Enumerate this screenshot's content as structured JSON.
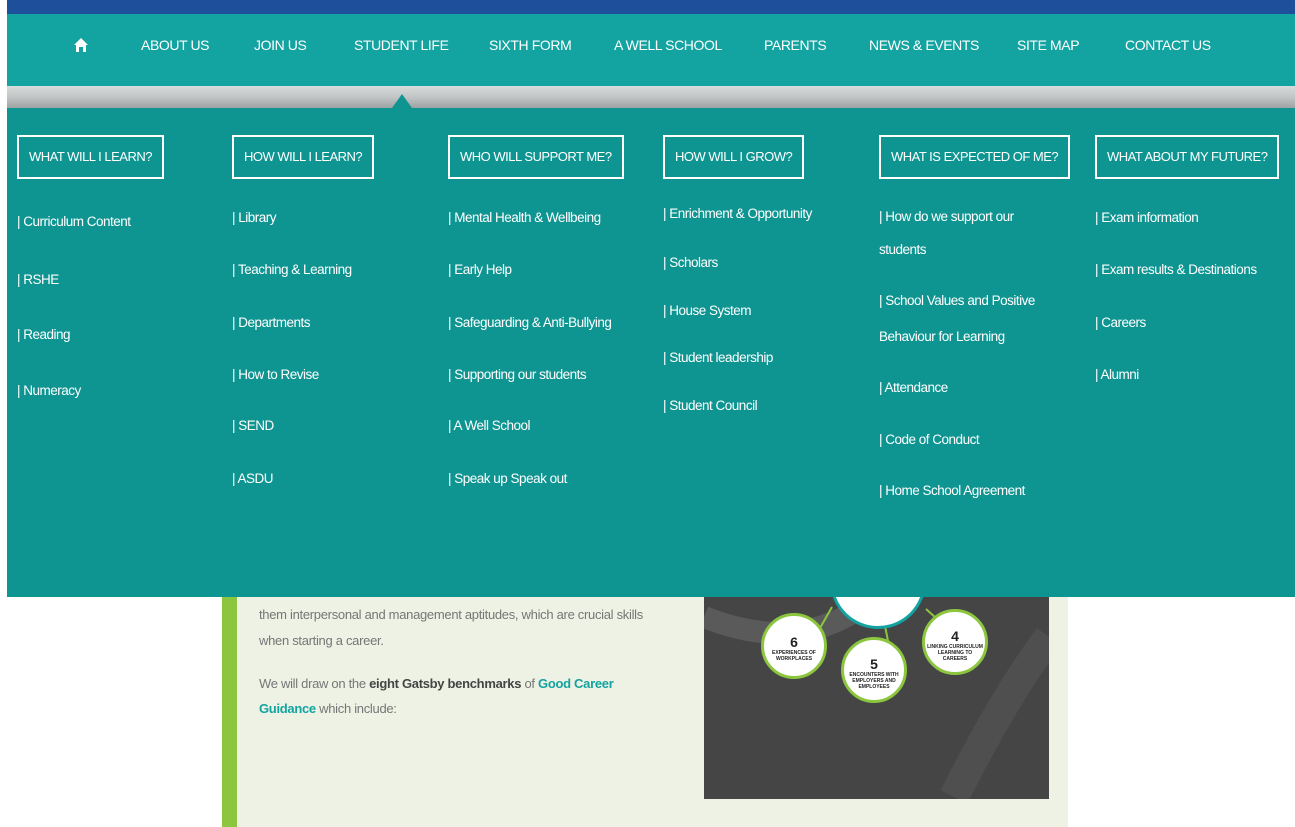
{
  "nav": {
    "home_icon": "home-icon",
    "items": [
      {
        "label": "ABOUT US"
      },
      {
        "label": "JOIN US"
      },
      {
        "label": "STUDENT LIFE"
      },
      {
        "label": "SIXTH FORM"
      },
      {
        "label": "A WELL SCHOOL"
      },
      {
        "label": "PARENTS"
      },
      {
        "label": "NEWS & EVENTS"
      },
      {
        "label": "SITE MAP"
      },
      {
        "label": "CONTACT US"
      }
    ]
  },
  "mega": {
    "columns": [
      {
        "heading": "WHAT WILL I LEARN?",
        "items": [
          "| Curriculum Content",
          "| RSHE",
          "| Reading",
          "| Numeracy"
        ]
      },
      {
        "heading": "HOW WILL I LEARN?",
        "items": [
          "| Library",
          "| Teaching & Learning",
          "| Departments",
          "| How to Revise",
          "| SEND",
          "| ASDU"
        ]
      },
      {
        "heading": "WHO WILL SUPPORT ME?",
        "items": [
          "| Mental Health & Wellbeing",
          "| Early Help",
          "| Safeguarding & Anti-Bullying",
          "| Supporting our students",
          "| A Well School",
          "| Speak up Speak out"
        ]
      },
      {
        "heading": "HOW WILL I GROW?",
        "items": [
          "| Enrichment & Opportunity",
          "| Scholars",
          "| House System",
          "| Student leadership",
          "| Student Council"
        ]
      },
      {
        "heading": "WHAT IS EXPECTED OF ME?",
        "items": [
          "| How do we support our",
          "students",
          "| School Values and Positive",
          "Behaviour for Learning",
          "| Attendance",
          "| Code of Conduct",
          "| Home School Agreement"
        ]
      },
      {
        "heading": "WHAT ABOUT MY FUTURE?",
        "items": [
          "| Exam information",
          "| Exam results & Destinations",
          "| Careers",
          "| Alumni"
        ]
      }
    ]
  },
  "content": {
    "line1": "them interpersonal and management aptitudes, which are crucial skills",
    "line2": "when starting a career.",
    "p2_pre": "We will draw on the ",
    "p2_bold": "eight Gatsby benchmarks",
    "p2_mid": " of ",
    "p2_link1": "Good Career",
    "p2_link2": "Guidance",
    "p2_post": " which include:"
  },
  "graphic": {
    "b6_num": "6",
    "b6_text": "EXPERIENCES OF WORKPLACES",
    "b5_num": "5",
    "b5_text": "ENCOUNTERS WITH EMPLOYERS AND EMPLOYEES",
    "b4_num": "4",
    "b4_text": "LINKING CURRICULUM LEARNING TO CAREERS"
  },
  "colors": {
    "nav": "#13a3a0",
    "mega": "#0f9591",
    "accent_green": "#8cc63f",
    "top_stripe": "#1d4f9a"
  }
}
